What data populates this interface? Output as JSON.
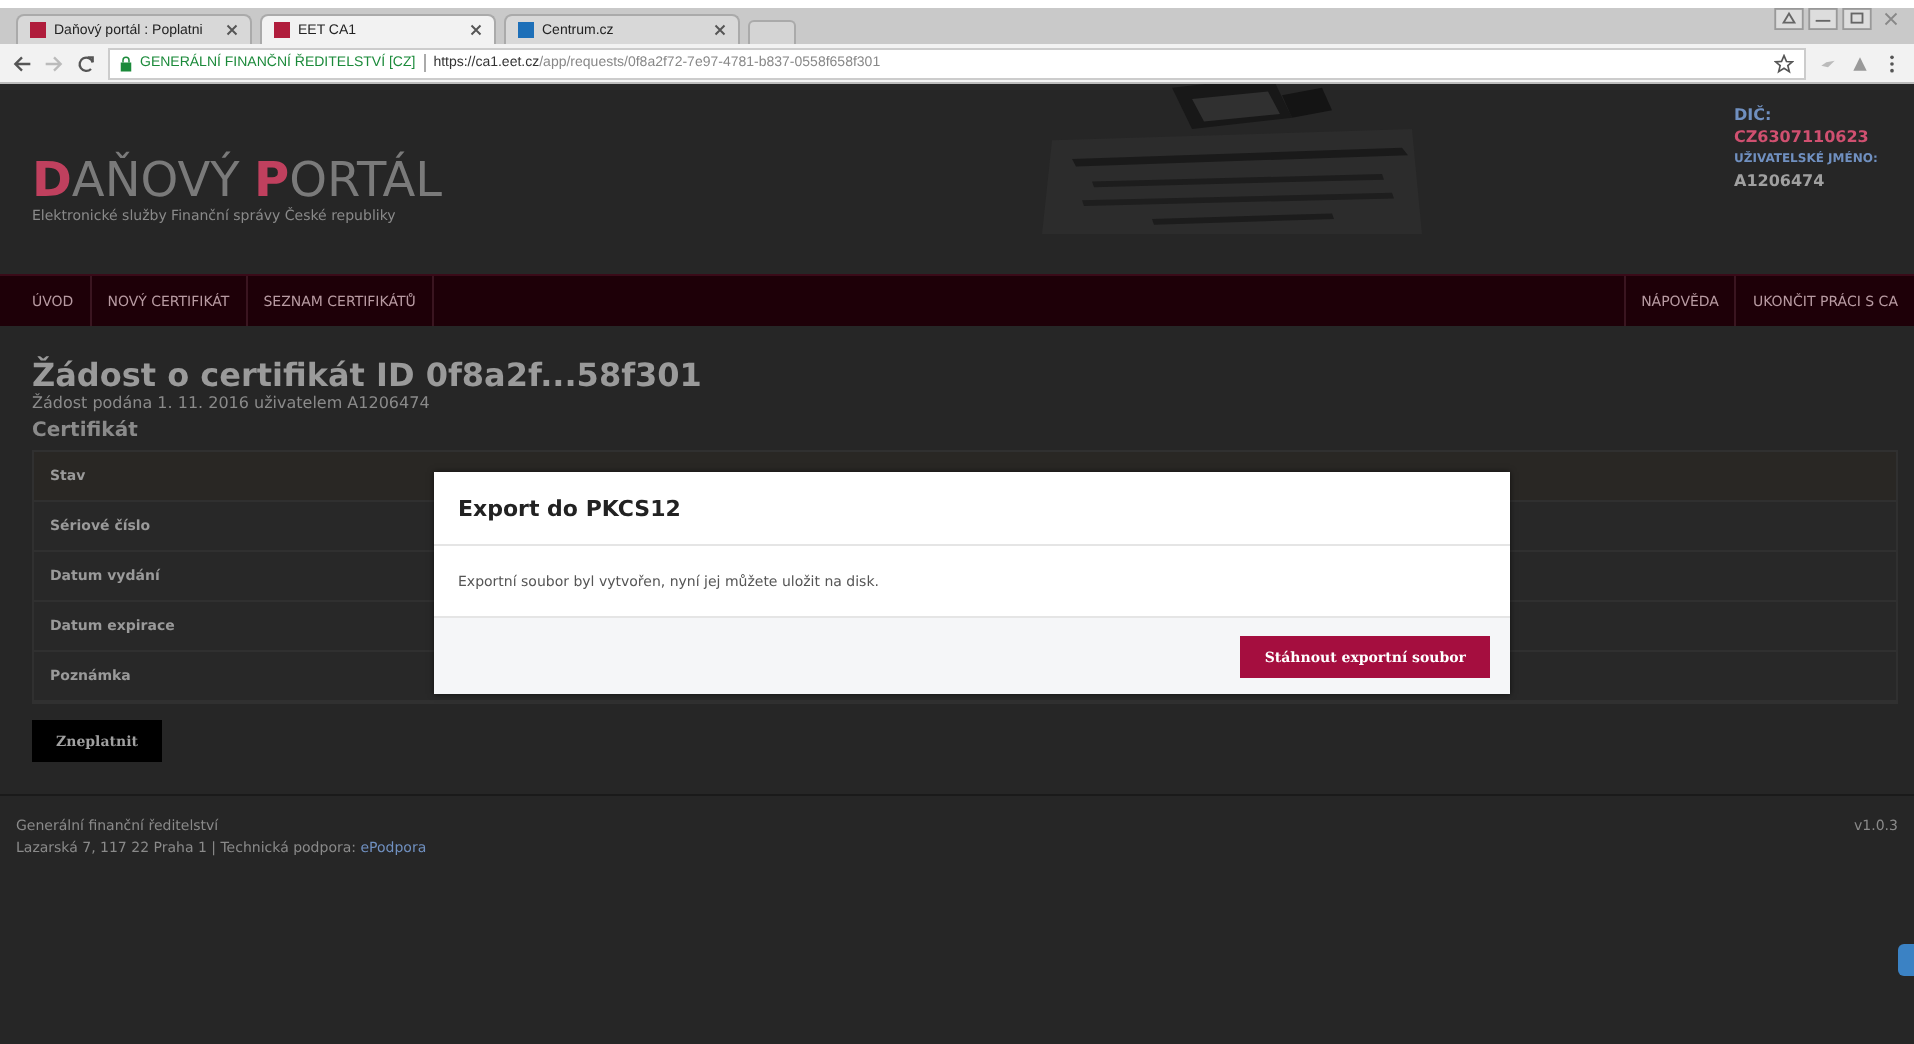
{
  "browser": {
    "tabs": [
      {
        "title": "Daňový portál : Poplatni",
        "selected": false
      },
      {
        "title": "EET CA1",
        "selected": true
      },
      {
        "title": "Centrum.cz",
        "selected": false
      }
    ],
    "security_label": "GENERÁLNÍ FINANČNÍ ŘEDITELSTVÍ [CZ]",
    "url_host": "https://ca1.eet.cz",
    "url_path": "/app/requests/0f8a2f72-7e97-4781-b837-0558f658f301"
  },
  "header": {
    "logo": [
      {
        "initial": "D",
        "rest": "AŇOVÝ"
      },
      {
        "initial": "P",
        "rest": "ORTÁL"
      }
    ],
    "subtitle": "Elektronické služby Finanční správy České republiky",
    "user": {
      "dic_label": "DIČ:",
      "dic": "CZ6307110623",
      "user_label": "UŽIVATELSKÉ JMÉNO:",
      "user_name": "A1206474"
    }
  },
  "nav": {
    "left": [
      "ÚVOD",
      "NOVÝ CERTIFIKÁT",
      "SEZNAM CERTIFIKÁTŮ"
    ],
    "right": [
      "NÁPOVĚDA",
      "UKONČIT PRÁCI S CA"
    ]
  },
  "content": {
    "title": "Žádost o certifikát ID 0f8a2f...58f301",
    "subtitle": "Žádost podána 1. 11. 2016 uživatelem A1206474",
    "section": "Certifikát",
    "fields": [
      "Stav",
      "Sériové číslo",
      "Datum vydání",
      "Datum expirace",
      "Poznámka"
    ],
    "button": "Zneplatnit"
  },
  "footer": {
    "org": "Generální finanční ředitelství",
    "address": "Lazarská 7, 117 22 Praha 1 | Technická podpora: ",
    "link": "ePodpora",
    "version": "v1.0.3"
  },
  "modal": {
    "title": "Export do PKCS12",
    "message": "Exportní soubor byl vytvořen, nyní jej můžete uložit na disk.",
    "button": "Stáhnout exportní soubor"
  }
}
